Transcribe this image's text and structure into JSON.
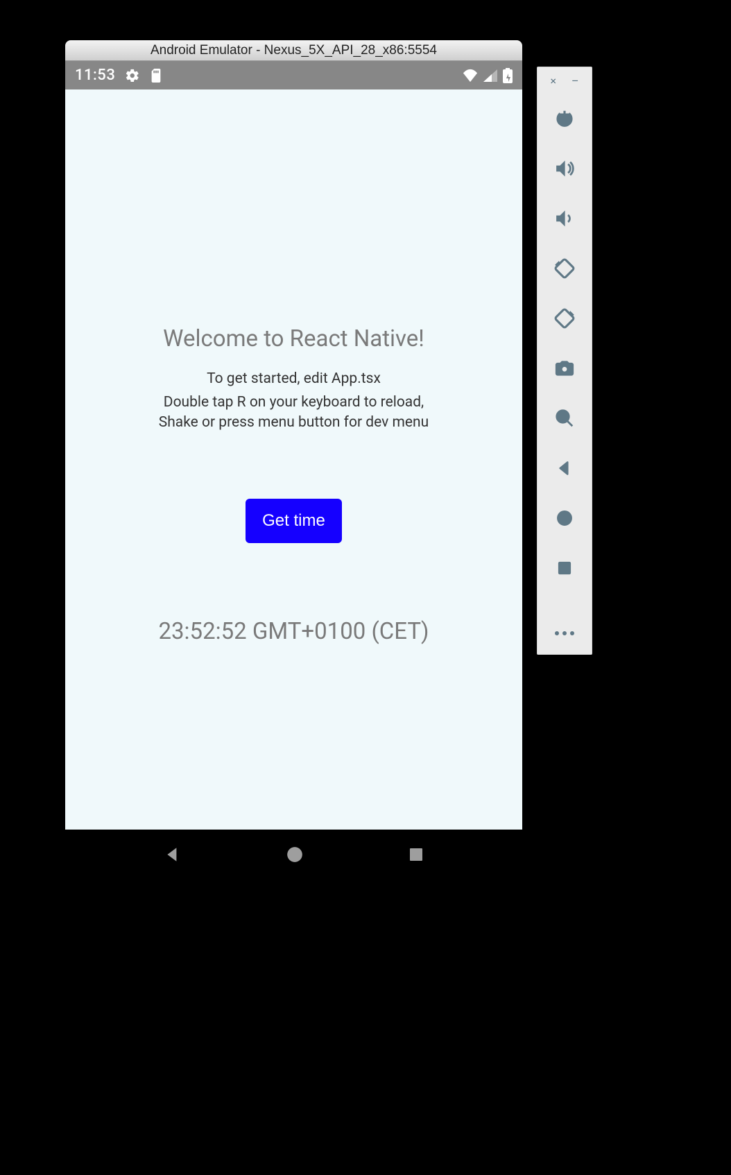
{
  "window": {
    "title": "Android Emulator - Nexus_5X_API_28_x86:5554"
  },
  "status_bar": {
    "time": "11:53"
  },
  "app": {
    "title": "Welcome to React Native!",
    "instructions_line1": "To get started, edit App.tsx",
    "instructions_line2a": "Double tap R on your keyboard to reload,",
    "instructions_line2b": "Shake or press menu button for dev menu",
    "button_label": "Get time",
    "time_output": "23:52:52 GMT+0100 (CET)"
  },
  "side_panel": {
    "close_glyph": "×",
    "minimize_glyph": "–"
  }
}
